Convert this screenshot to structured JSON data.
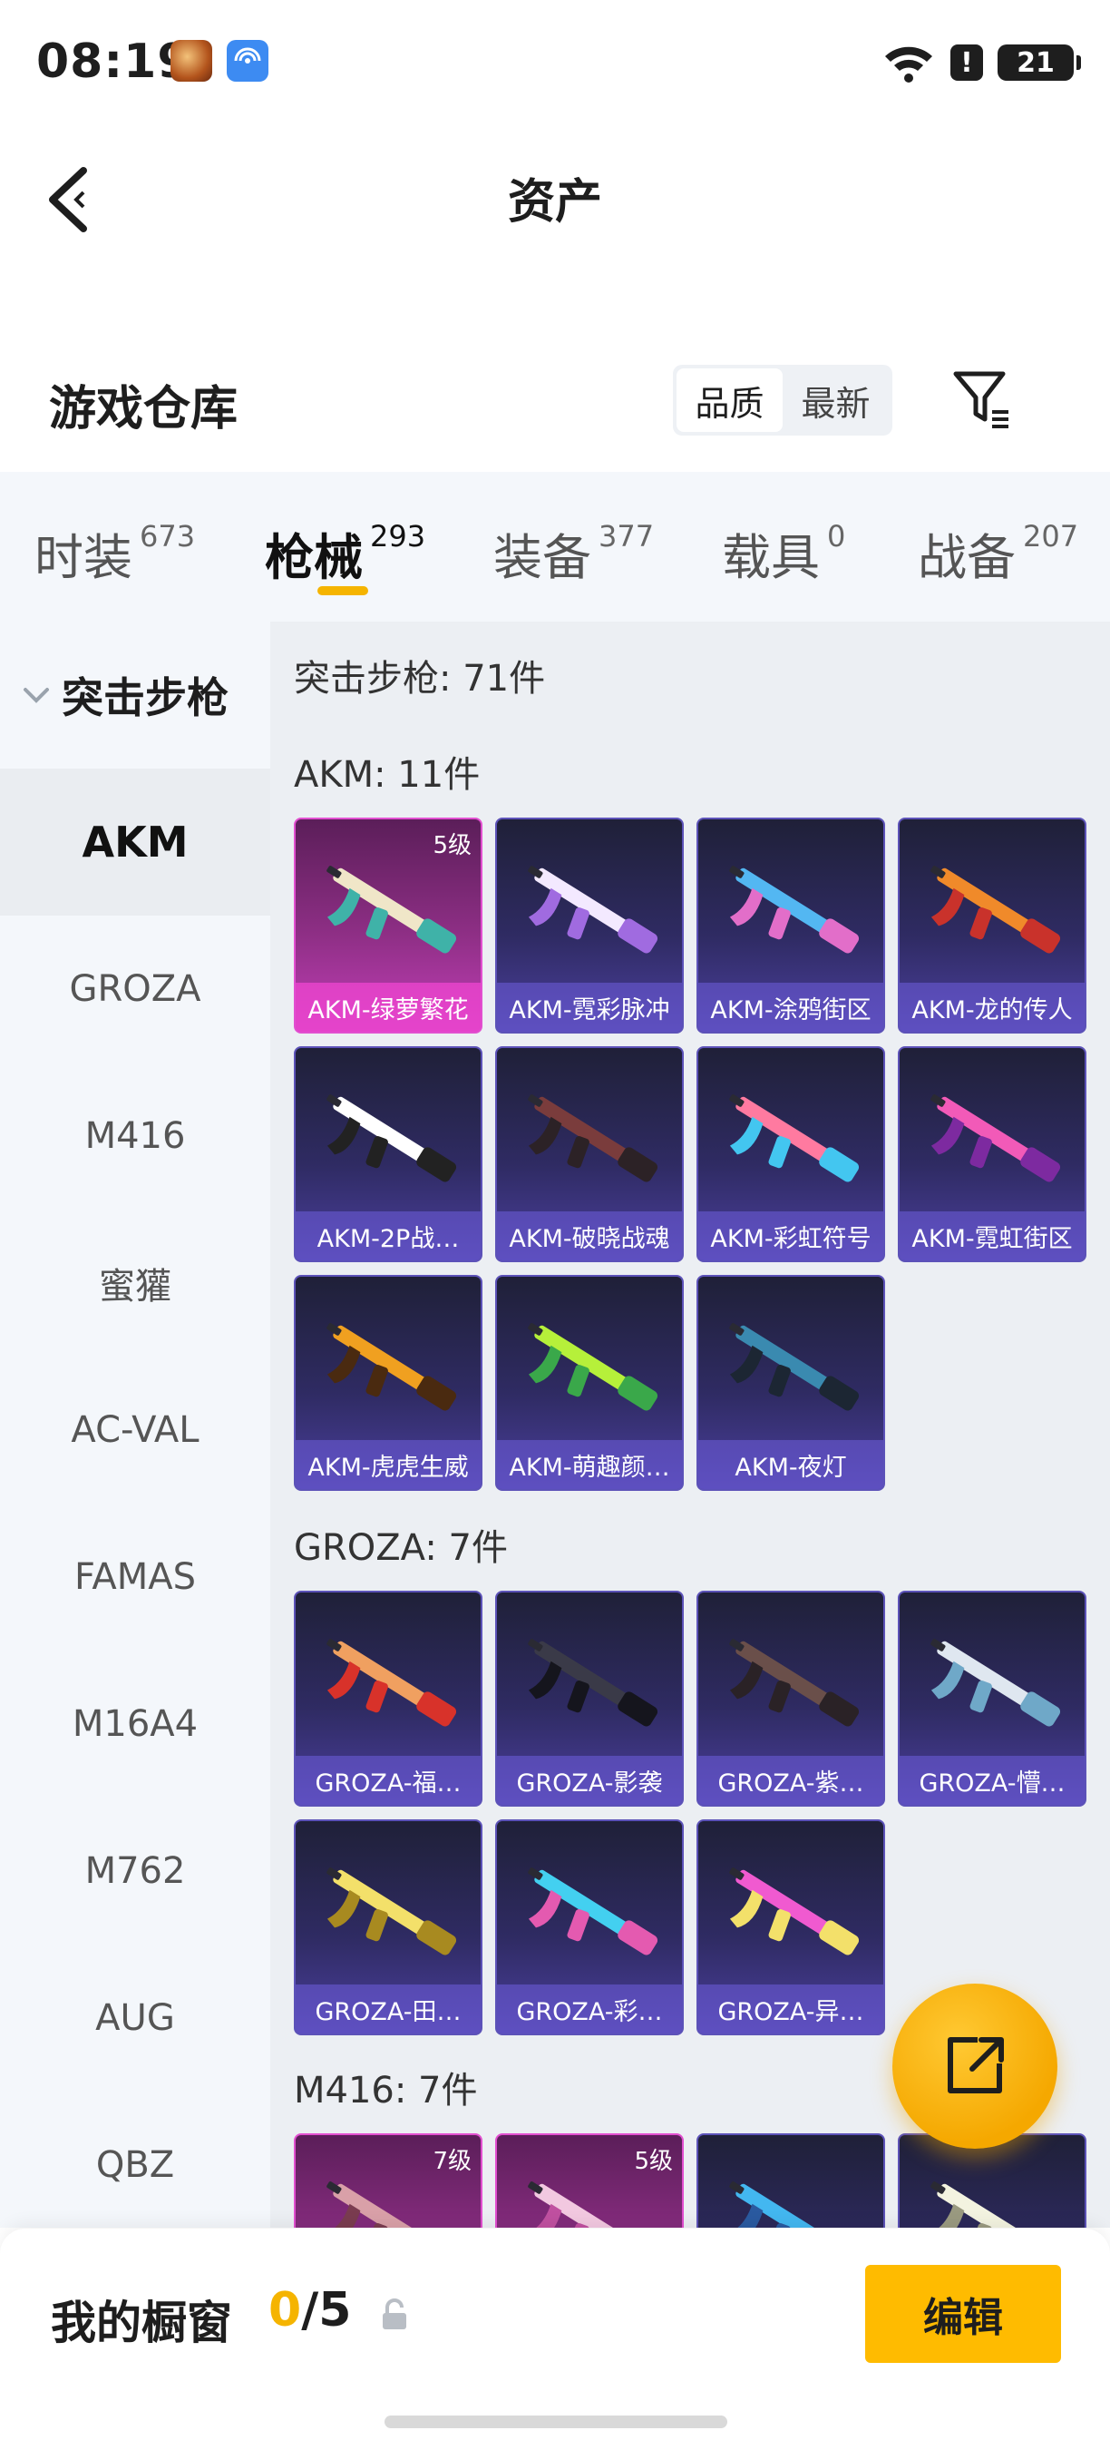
{
  "status_bar": {
    "time": "08:19",
    "battery": "21"
  },
  "header": {
    "title": "资产"
  },
  "warehouse": {
    "title": "游戏仓库",
    "sort_options": [
      {
        "label": "品质",
        "active": true
      },
      {
        "label": "最新",
        "active": false
      }
    ]
  },
  "tabs": [
    {
      "label": "时装",
      "count": "673",
      "active": false
    },
    {
      "label": "枪械",
      "count": "293",
      "active": true
    },
    {
      "label": "装备",
      "count": "377",
      "active": false
    },
    {
      "label": "载具",
      "count": "0",
      "active": false
    },
    {
      "label": "战备",
      "count": "207",
      "active": false
    }
  ],
  "sidebar": {
    "group": "突击步枪",
    "items": [
      "AKM",
      "GROZA",
      "M416",
      "蜜獾",
      "AC-VAL",
      "FAMAS",
      "M16A4",
      "M762",
      "AUG",
      "QBZ"
    ],
    "active_index": 0
  },
  "content": {
    "summary": "突击步枪: 71件",
    "sections": [
      {
        "title": "AKM: 11件",
        "items": [
          {
            "name": "AKM-绿萝繁花",
            "level": "5级",
            "rarity": "pink",
            "colors": [
              "#f0e6c8",
              "#3fb2a8"
            ]
          },
          {
            "name": "AKM-霓彩脉冲",
            "level": "",
            "rarity": "purple",
            "colors": [
              "#f3e9ff",
              "#a06be0"
            ]
          },
          {
            "name": "AKM-涂鸦街区",
            "level": "",
            "rarity": "purple",
            "colors": [
              "#53b7f2",
              "#e26ec9"
            ]
          },
          {
            "name": "AKM-龙的传人",
            "level": "",
            "rarity": "purple",
            "colors": [
              "#f08a2a",
              "#c9322b"
            ]
          },
          {
            "name": "AKM-2P战…",
            "level": "",
            "rarity": "purple",
            "colors": [
              "#ffffff",
              "#222222"
            ]
          },
          {
            "name": "AKM-破晓战魂",
            "level": "",
            "rarity": "purple",
            "colors": [
              "#7a3c3c",
              "#2c2226"
            ]
          },
          {
            "name": "AKM-彩虹符号",
            "level": "",
            "rarity": "purple",
            "colors": [
              "#ff7aa0",
              "#43c6f0"
            ]
          },
          {
            "name": "AKM-霓虹街区",
            "level": "",
            "rarity": "purple",
            "colors": [
              "#f25ab8",
              "#7d2aa0"
            ]
          },
          {
            "name": "AKM-虎虎生威",
            "level": "",
            "rarity": "purple",
            "colors": [
              "#f0a020",
              "#4a2a10"
            ]
          },
          {
            "name": "AKM-萌趣颜…",
            "level": "",
            "rarity": "purple",
            "colors": [
              "#b6f03a",
              "#3aa84a"
            ]
          },
          {
            "name": "AKM-夜灯",
            "level": "",
            "rarity": "purple",
            "colors": [
              "#3a8ab0",
              "#1c2633"
            ]
          }
        ]
      },
      {
        "title": "GROZA: 7件",
        "items": [
          {
            "name": "GROZA-福…",
            "level": "",
            "rarity": "purple",
            "colors": [
              "#f0a060",
              "#d8322a"
            ]
          },
          {
            "name": "GROZA-影袭",
            "level": "",
            "rarity": "purple",
            "colors": [
              "#3a3a48",
              "#15151d"
            ]
          },
          {
            "name": "GROZA-紫…",
            "level": "",
            "rarity": "purple",
            "colors": [
              "#6a4f4a",
              "#2a2226"
            ]
          },
          {
            "name": "GROZA-懵…",
            "level": "",
            "rarity": "purple",
            "colors": [
              "#dfe7f0",
              "#6fa8c8"
            ]
          },
          {
            "name": "GROZA-田…",
            "level": "",
            "rarity": "purple",
            "colors": [
              "#f3e06a",
              "#a88a20"
            ]
          },
          {
            "name": "GROZA-彩…",
            "level": "",
            "rarity": "purple",
            "colors": [
              "#43d0f0",
              "#e45ab0"
            ]
          },
          {
            "name": "GROZA-异…",
            "level": "",
            "rarity": "purple",
            "colors": [
              "#f05ad0",
              "#f3e06a"
            ]
          }
        ]
      },
      {
        "title": "M416: 7件",
        "items": [
          {
            "name": "",
            "level": "7级",
            "rarity": "pink",
            "colors": [
              "#d9a0a8",
              "#7a3c50"
            ]
          },
          {
            "name": "",
            "level": "5级",
            "rarity": "pink",
            "colors": [
              "#f2c8e0",
              "#c050a0"
            ]
          },
          {
            "name": "",
            "level": "",
            "rarity": "purple",
            "colors": [
              "#43b7f0",
              "#2a5aa0"
            ]
          },
          {
            "name": "",
            "level": "",
            "rarity": "purple",
            "colors": [
              "#f3f3e0",
              "#9a9a80"
            ]
          }
        ]
      }
    ]
  },
  "showcase": {
    "label": "我的橱窗",
    "used": "0",
    "separator": "/",
    "total": "5",
    "edit_label": "编辑"
  }
}
